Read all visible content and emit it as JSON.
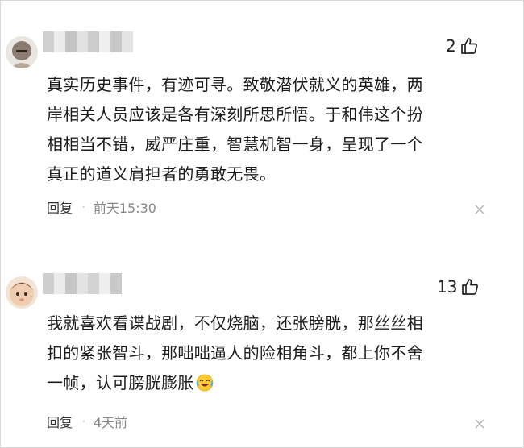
{
  "comments": [
    {
      "likes": "2",
      "lines": [
        "真实历史事件，有迹可寻。致敬潜伏就义的英雄，两",
        "岸相关人员应该是各有深刻所思所悟。于和伟这个扮",
        "相相当不错，威严庄重，智慧机智一身，呈现了一个",
        "真正的道义肩担者的勇敢无畏。"
      ],
      "reply_label": "回复",
      "separator": "·",
      "time": "前天15:30"
    },
    {
      "likes": "13",
      "lines": [
        "我就喜欢看谍战剧，不仅烧脑，还张膀胱，那丝丝相",
        "扣的紧张智斗，那咄咄逼人的险相角斗，都上你不舍",
        "一帧，认可膀胱膨胀"
      ],
      "reply_label": "回复",
      "separator": "·",
      "time": "4天前"
    }
  ],
  "icons": {
    "like": "thumbs-up-icon",
    "close": "close-icon",
    "emoji": "laughing-crying-emoji-icon"
  },
  "colors": {
    "text": "#1c1c1c",
    "meta": "#888888",
    "blur_a": "#c9c9c9",
    "blur_b": "#e6e6e6"
  }
}
